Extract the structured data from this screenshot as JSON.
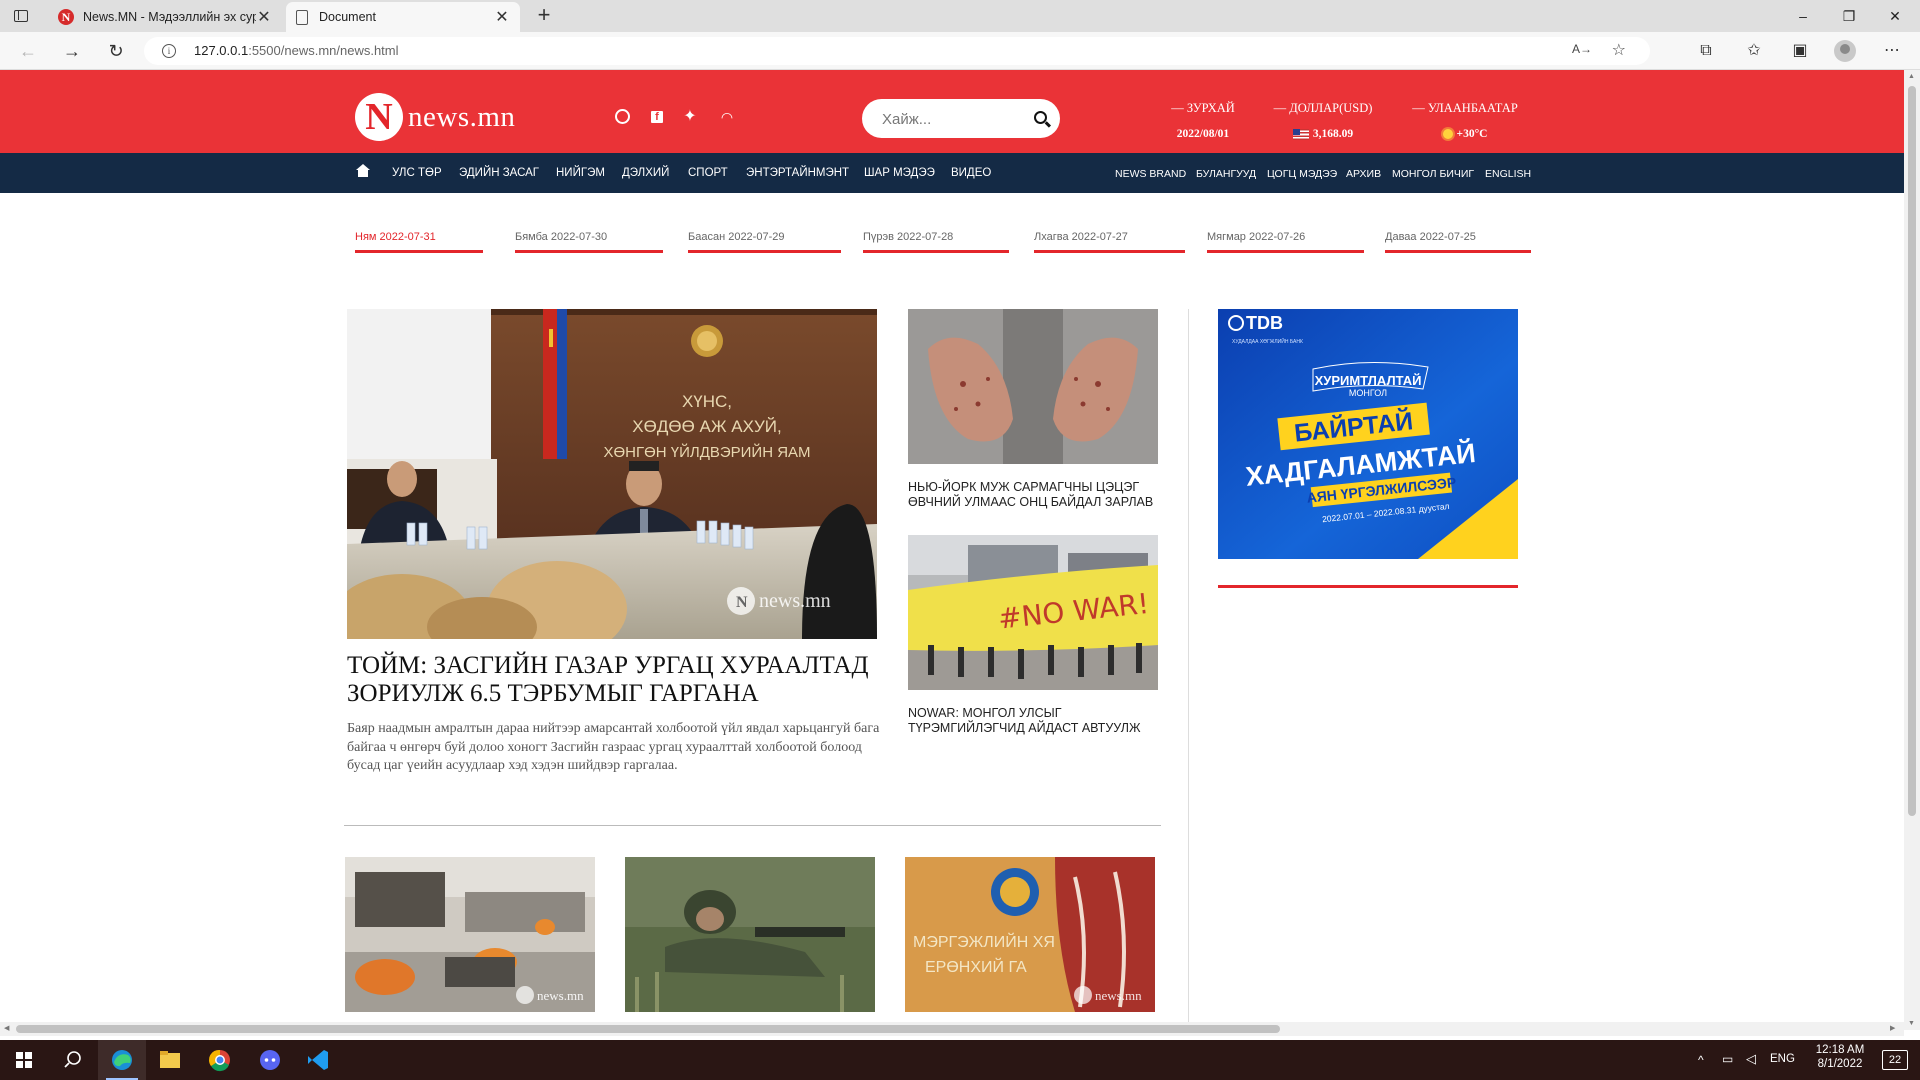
{
  "browser": {
    "tabs": [
      {
        "title": "News.MN - Мэдээллийн эх сурвалж",
        "active": false
      },
      {
        "title": "Document",
        "active": true
      }
    ],
    "url_host": "127.0.0.1",
    "url_path": ":5500/news.mn/news.html",
    "read_aloud_label": "A→",
    "window_controls": {
      "minimize": "–",
      "restore": "❐",
      "close": "✕"
    }
  },
  "header": {
    "logo_letter": "N",
    "logo_text": "news.mn",
    "search_placeholder": "Хайж...",
    "zurkhai_label": "— ЗУРХАЙ",
    "zurkhai_value": "2022/08/01",
    "dollar_label": "— ДОЛЛАР(USD)",
    "dollar_value": "3,168.09",
    "ub_label": "— УЛААНБААТАР",
    "ub_value": "+30°C",
    "colors": {
      "brand_red": "#ea3337",
      "nav_navy": "#142a45"
    }
  },
  "nav": {
    "main": [
      "УЛС ТӨР",
      "ЭДИЙН ЗАСАГ",
      "НИЙГЭМ",
      "ДЭЛХИЙ",
      "СПОРТ",
      "ЭНТЭРТАЙНМЭНТ",
      "ШАР МЭДЭЭ",
      "ВИДЕО"
    ],
    "secondary": [
      "NEWS BRAND",
      "БУЛАНГУУД",
      "ЦОГЦ МЭДЭЭ",
      "АРХИВ",
      "МОНГОЛ БИЧИГ",
      "ENGLISH"
    ]
  },
  "date_tabs": [
    {
      "label": "Ням 2022-07-31",
      "active": true
    },
    {
      "label": "Бямба 2022-07-30",
      "active": false
    },
    {
      "label": "Баасан 2022-07-29",
      "active": false
    },
    {
      "label": "Пүрэв 2022-07-28",
      "active": false
    },
    {
      "label": "Лхагва 2022-07-27",
      "active": false
    },
    {
      "label": "Мягмар 2022-07-26",
      "active": false
    },
    {
      "label": "Даваа 2022-07-25",
      "active": false
    }
  ],
  "feature": {
    "image_sign_line1": "ХҮНС,",
    "image_sign_line2": "ХӨДӨӨ АЖ АХУЙ,",
    "image_sign_line3": "ХӨНГӨН ҮЙЛДВЭРИЙН ЯАМ",
    "watermark": "news.mn",
    "title": "ТОЙМ: ЗАСГИЙН ГАЗАР УРГАЦ ХУРААЛТАД ЗОРИУЛЖ 6.5 ТЭРБУМЫГ ГАРГАНА",
    "description": "Баяр наадмын амралтын дараа нийтээр амарсантай холбоотой үйл явдал харьцангуй бага байгаа ч өнгөрч буй долоо хоногт Засгийн газраас ургац хураалттай холбоотой болоод бусад цаг үеийн асуудлаар хэд хэдэн шийдвэр гаргалаа."
  },
  "side_news": [
    {
      "title": "НЬЮ-ЙОРК МУЖ САРМАГЧНЫ ЦЭЦЭГ ӨВЧНИЙ УЛМААС ОНЦ БАЙДАЛ ЗАРЛАВ"
    },
    {
      "title": "NOWAR: МОНГОЛ УЛСЫГ ТҮРЭМГИЙЛЭГЧИД АЙДАСТ АВТУУЛЖ",
      "banner_text": "#NO WAR!"
    }
  ],
  "ad": {
    "brand": "TDB",
    "brand_sub": "ХУДАЛДАА ХӨГЖЛИЙН БАНК",
    "campaign_line1": "ХУРИМТЛАЛТАЙ",
    "campaign_line2": "МОНГОЛ",
    "headline1": "БАЙРТАЙ",
    "headline2": "ХАДГАЛАМЖТАЙ",
    "subhead": "АЯН ҮРГЭЛЖИЛСЭЭР",
    "dates": "2022.07.01 – 2022.08.31 дуустал"
  },
  "bottom_news": [
    {
      "watermark": "news.mn"
    },
    {
      "watermark": ""
    },
    {
      "overlay_line1": "МЭРГЭЖЛИЙН ХЯ",
      "overlay_line2": "ЕРӨНХИЙ ГА",
      "watermark": "news.mn"
    }
  ],
  "taskbar": {
    "apps": [
      "windows-start",
      "search",
      "edge",
      "file-explorer",
      "chrome",
      "discord",
      "vscode"
    ],
    "language": "ENG",
    "time": "12:18 AM",
    "date": "8/1/2022",
    "notification_count": "22"
  }
}
